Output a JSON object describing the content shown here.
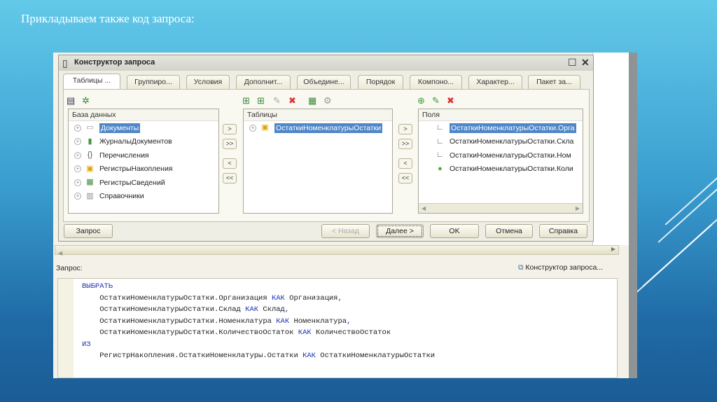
{
  "slide": {
    "title": "Прикладываем также код запроса:"
  },
  "dialog": {
    "title": "Конструктор запроса",
    "tabs": [
      "Таблицы ...",
      "Группиро...",
      "Условия",
      "Дополнит...",
      "Объедине...",
      "Порядок",
      "Компоно...",
      "Характер...",
      "Пакет за..."
    ],
    "database": {
      "header": "База данных",
      "items": [
        "Документы",
        "ЖурналыДокументов",
        "Перечисления",
        "РегистрыНакопления",
        "РегистрыСведений",
        "Справочники"
      ]
    },
    "tables": {
      "header": "Таблицы",
      "items": [
        "ОстаткиНоменклатурыОстатки"
      ]
    },
    "fields": {
      "header": "Поля",
      "items": [
        "ОстаткиНоменклатурыОстатки.Орга",
        "ОстаткиНоменклатурыОстатки.Скла",
        "ОстаткиНоменклатурыОстатки.Ном",
        "ОстаткиНоменклатурыОстатки.Коли"
      ]
    },
    "arrows": [
      ">",
      ">>",
      "<",
      "<<"
    ],
    "buttons": {
      "query": "Запрос",
      "back": "< Назад",
      "next": "Далее >",
      "ok": "OK",
      "cancel": "Отмена",
      "help": "Справка"
    }
  },
  "query": {
    "label": "Запрос:",
    "constructor_link": "Конструктор запроса...",
    "lines": [
      [
        [
          "kw",
          "ВЫБРАТЬ"
        ]
      ],
      [
        [
          "t",
          "    ОстаткиНоменклатурыОстатки.Организация "
        ],
        [
          "kw",
          "КАК"
        ],
        [
          "t",
          " Организация"
        ],
        [
          "kw",
          ","
        ]
      ],
      [
        [
          "t",
          "    ОстаткиНоменклатурыОстатки.Склад "
        ],
        [
          "kw",
          "КАК"
        ],
        [
          "t",
          " Склад"
        ],
        [
          "kw",
          ","
        ]
      ],
      [
        [
          "t",
          "    ОстаткиНоменклатурыОстатки.Номенклатура "
        ],
        [
          "kw",
          "КАК"
        ],
        [
          "t",
          " Номенклатура"
        ],
        [
          "kw",
          ","
        ]
      ],
      [
        [
          "t",
          "    ОстаткиНоменклатурыОстатки.КоличествоОстаток "
        ],
        [
          "kw",
          "КАК"
        ],
        [
          "t",
          " КоличествоОстаток"
        ]
      ],
      [
        [
          "kw",
          "ИЗ"
        ]
      ],
      [
        [
          "t",
          "    РегистрНакопления.ОстаткиНоменклатуры.Остатки "
        ],
        [
          "kw",
          "КАК"
        ],
        [
          "t",
          " ОстаткиНоменклатурыОстатки"
        ]
      ]
    ]
  }
}
